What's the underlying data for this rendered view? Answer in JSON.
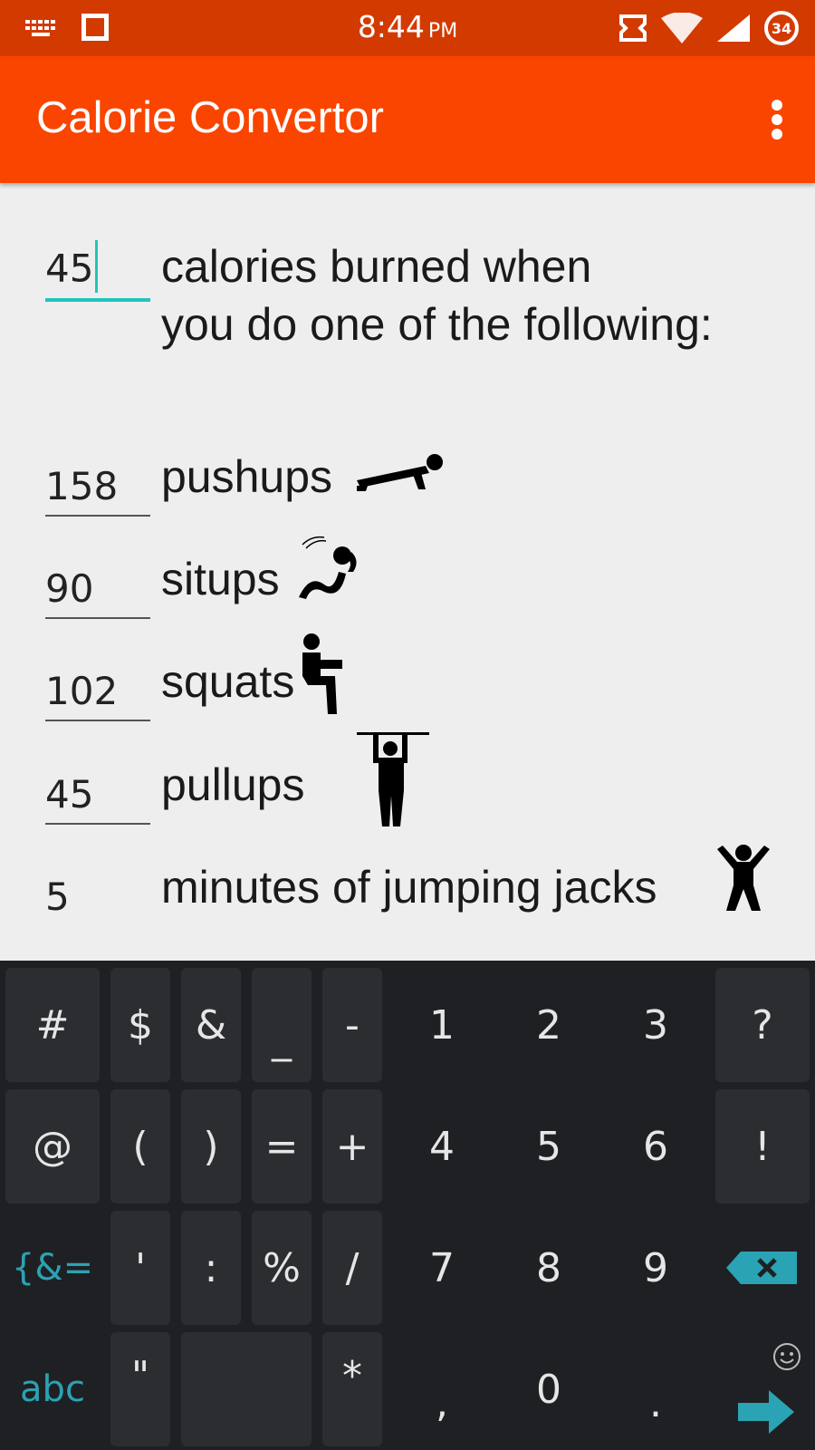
{
  "status_bar": {
    "time": "8:44",
    "ampm": "PM",
    "battery": "34"
  },
  "app_bar": {
    "title": "Calorie Convertor",
    "menu_icon": "overflow-menu-icon"
  },
  "input": {
    "calories": "45",
    "label_line1": "calories burned when",
    "label_line2": "you do one of the following:"
  },
  "exercises": [
    {
      "value": "158",
      "label": "pushups",
      "icon": "pushup-icon"
    },
    {
      "value": "90",
      "label": "situps",
      "icon": "situp-icon"
    },
    {
      "value": "102",
      "label": "squats",
      "icon": "squat-icon"
    },
    {
      "value": "45",
      "label": "pullups",
      "icon": "pullup-icon"
    },
    {
      "value": "5",
      "label": "minutes of jumping jacks",
      "icon": "jumping-jack-icon"
    }
  ],
  "keyboard": {
    "row1": [
      "#",
      "$",
      "&",
      "_",
      "-",
      "1",
      "2",
      "3",
      "?"
    ],
    "row2": [
      "@",
      "(",
      ")",
      "=",
      "+",
      "4",
      "5",
      "6",
      "!"
    ],
    "row3": [
      "{&=",
      "'",
      ":",
      "%",
      "/",
      "7",
      "8",
      "9"
    ],
    "row4": [
      "abc",
      "\"",
      "*",
      ",",
      "0",
      "."
    ],
    "accent": "#2aa3b4"
  }
}
